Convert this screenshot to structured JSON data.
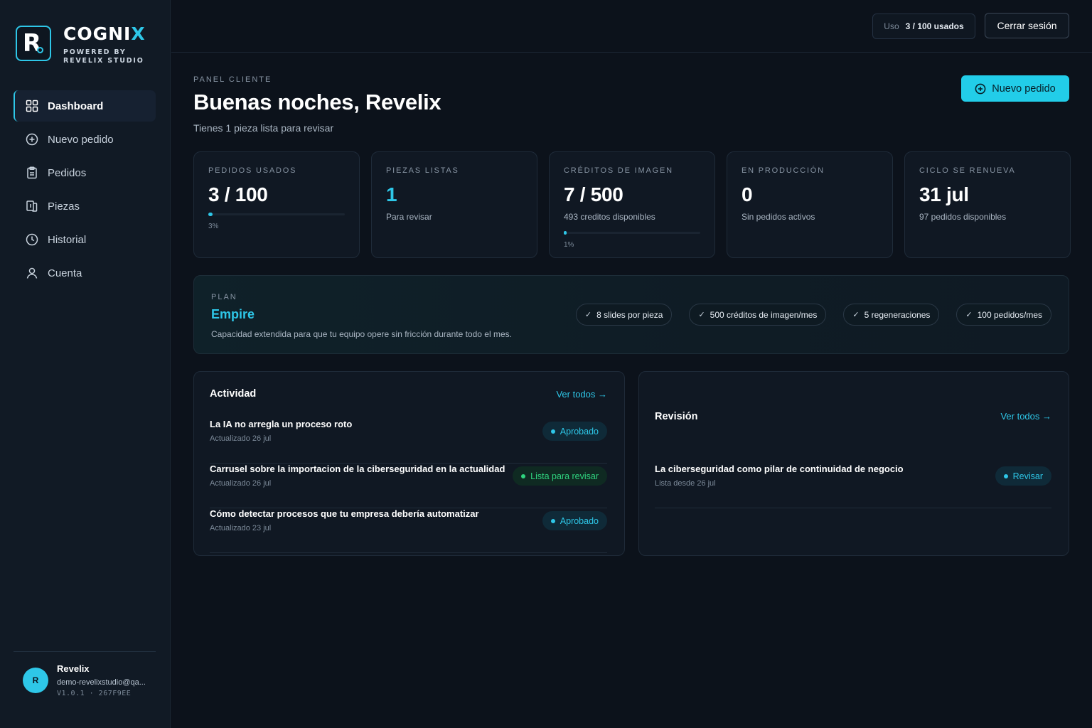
{
  "brand": {
    "name_main": "COGNI",
    "name_accent": "X",
    "subtitle": "POWERED BY REVELIX STUDIO",
    "logo_letter": "R"
  },
  "sidebar": {
    "items": [
      {
        "label": "Dashboard",
        "icon": "grid-icon",
        "active": true
      },
      {
        "label": "Nuevo pedido",
        "icon": "plus-circle-icon"
      },
      {
        "label": "Pedidos",
        "icon": "clipboard-icon"
      },
      {
        "label": "Piezas",
        "icon": "files-icon"
      },
      {
        "label": "Historial",
        "icon": "clock-icon"
      },
      {
        "label": "Cuenta",
        "icon": "user-icon"
      }
    ],
    "user": {
      "initial": "R",
      "name": "Revelix",
      "email": "demo-revelixstudio@qa...",
      "version": "V1.0.1 · 267F9EE"
    }
  },
  "topbar": {
    "usage_label": "Uso",
    "usage_value": "3 / 100 usados",
    "logout_label": "Cerrar sesión"
  },
  "header": {
    "eyebrow": "PANEL CLIENTE",
    "greeting": "Buenas noches, Revelix",
    "subtitle": "Tienes 1 pieza lista para revisar",
    "new_order_label": "Nuevo pedido"
  },
  "stats": [
    {
      "label": "PEDIDOS USADOS",
      "value": "3 / 100",
      "progress": 0.03,
      "pct": "3%"
    },
    {
      "label": "PIEZAS LISTAS",
      "value": "1",
      "note": "Para revisar",
      "accent": true
    },
    {
      "label": "CRÉDITOS DE IMAGEN",
      "value": "7 / 500",
      "note": "493 creditos disponibles",
      "progress": 0.01,
      "pct": "1%"
    },
    {
      "label": "EN PRODUCCIÓN",
      "value": "0",
      "note": "Sin pedidos activos"
    },
    {
      "label": "CICLO SE RENUEVA",
      "value": "31 jul",
      "note": "97 pedidos disponibles"
    }
  ],
  "plan": {
    "eyebrow": "PLAN",
    "name": "Empire",
    "description": "Capacidad extendida para que tu equipo opere sin fricción durante todo el mes.",
    "features": [
      "8 slides por pieza",
      "500 créditos de imagen/mes",
      "5 regeneraciones",
      "100 pedidos/mes"
    ]
  },
  "activity": {
    "title": "Actividad",
    "see_all": "Ver todos →",
    "rows": [
      {
        "title": "La IA no arregla un proceso roto",
        "sub": "Actualizado 26 jul",
        "status": "Aprobado",
        "tone": "blue"
      },
      {
        "title": "Carrusel sobre la importacion de la ciberseguridad en la actualidad",
        "sub": "Actualizado 26 jul",
        "status": "Lista para revisar",
        "tone": "green"
      },
      {
        "title": "Cómo detectar procesos que tu empresa debería automatizar",
        "sub": "Actualizado 23 jul",
        "status": "Aprobado",
        "tone": "blue"
      }
    ]
  },
  "review": {
    "title": "Revisión",
    "see_all": "Ver todos →",
    "rows": [
      {
        "title": "La ciberseguridad como pilar de continuidad de negocio",
        "sub": "Lista desde 26 jul",
        "status": "Revisar",
        "tone": "blue"
      }
    ]
  },
  "colors": {
    "accent": "#2ec7e8",
    "success": "#2fd47f",
    "background": "#0c121b"
  }
}
